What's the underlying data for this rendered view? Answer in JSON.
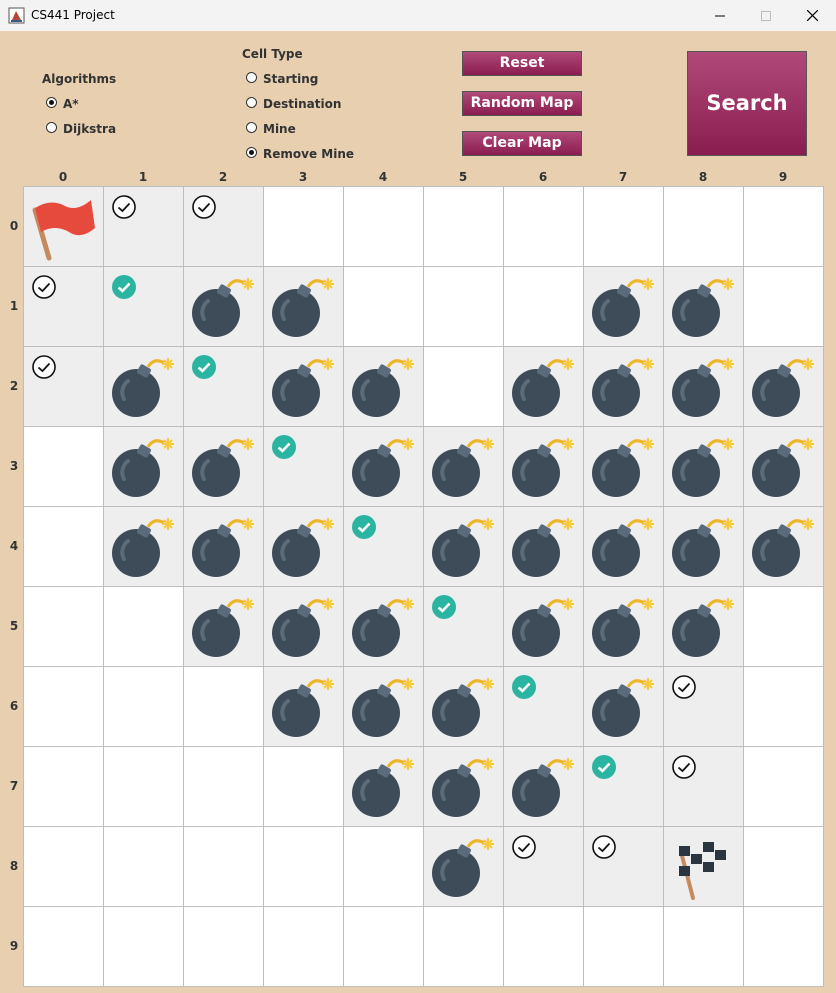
{
  "window": {
    "title": "CS441 Project"
  },
  "algorithms": {
    "heading": "Algorithms",
    "options": [
      {
        "label": "A*",
        "selected": true
      },
      {
        "label": "Dijkstra",
        "selected": false
      }
    ]
  },
  "cell_type": {
    "heading": "Cell Type",
    "options": [
      {
        "label": "Starting",
        "selected": false
      },
      {
        "label": "Destination",
        "selected": false
      },
      {
        "label": "Mine",
        "selected": false
      },
      {
        "label": "Remove Mine",
        "selected": true
      }
    ]
  },
  "buttons": {
    "reset": "Reset",
    "random_map": "Random Map",
    "clear_map": "Clear Map",
    "search": "Search"
  },
  "grid": {
    "column_labels": [
      "0",
      "1",
      "2",
      "3",
      "4",
      "5",
      "6",
      "7",
      "8",
      "9"
    ],
    "row_labels": [
      "0",
      "1",
      "2",
      "3",
      "4",
      "5",
      "6",
      "7",
      "8",
      "9"
    ],
    "legend": {
      "S": "start-flag",
      "D": "destination-flag",
      "M": "mine",
      "V": "visited",
      "P": "path",
      "W": "empty-shaded",
      ".": "empty"
    },
    "rows": [
      "SVV.......",
      "VPMM...MM.",
      "VMPMM.MMMM",
      ".MMPMMMMMM",
      ".MMMPMMMMM",
      "..MMMPMMM.",
      "...MMMPMV.",
      "....MMMPV.",
      ".....MVVD.",
      ".........."
    ]
  },
  "colors": {
    "background": "#e8cfb0",
    "button": "#9b2d5e",
    "shaded_cell": "#eeeeee",
    "empty_cell": "#ffffff",
    "path_check": "#2bb5a0",
    "mine": "#3e4c59",
    "start_flag": "#e64a3c"
  }
}
